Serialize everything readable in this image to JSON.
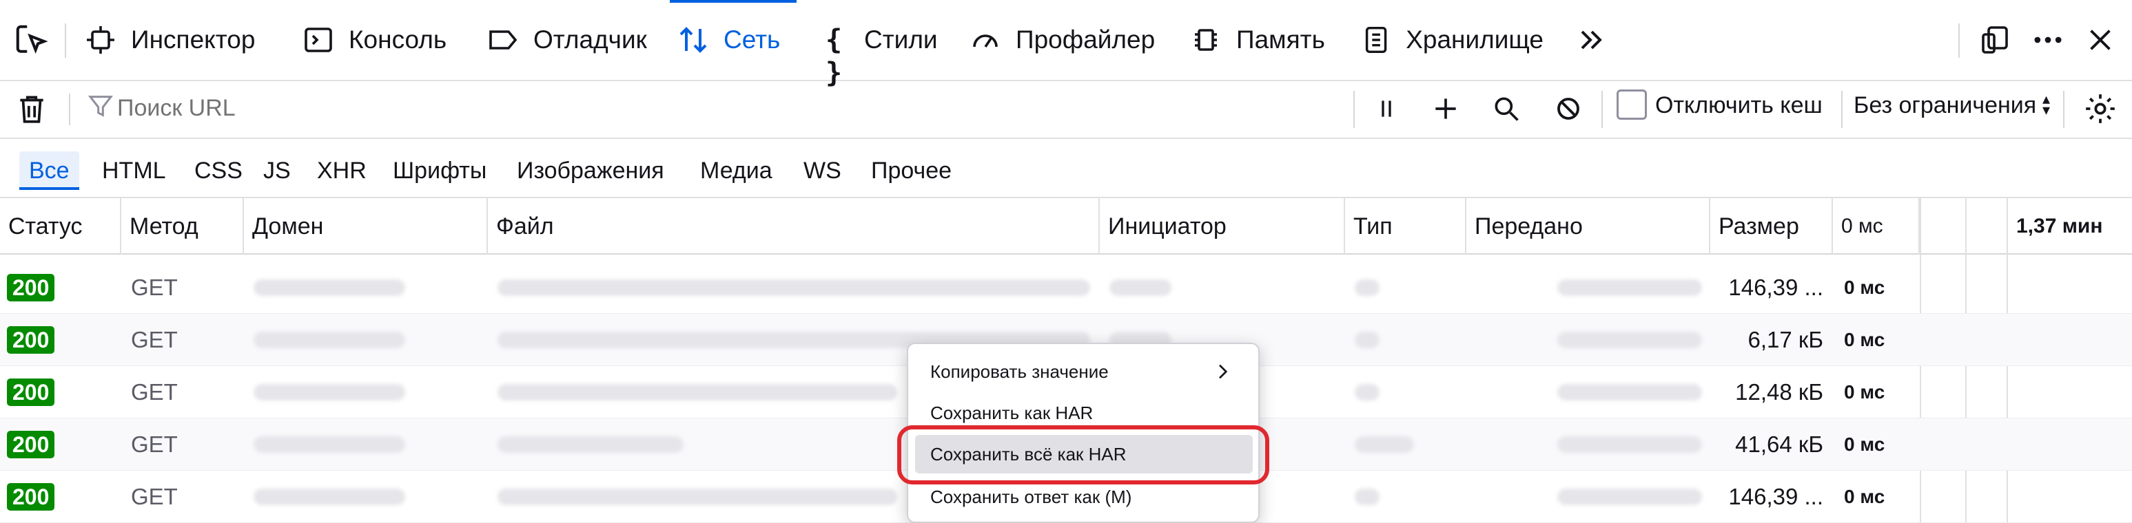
{
  "toolbox": {
    "tabs": [
      {
        "label": "Инспектор",
        "icon": "inspector-icon"
      },
      {
        "label": "Консоль",
        "icon": "console-icon"
      },
      {
        "label": "Отладчик",
        "icon": "debugger-icon"
      },
      {
        "label": "Сеть",
        "icon": "network-icon"
      },
      {
        "label": "Стили",
        "icon": "style-editor-icon"
      },
      {
        "label": "Профайлер",
        "icon": "profiler-icon"
      },
      {
        "label": "Память",
        "icon": "memory-icon"
      },
      {
        "label": "Хранилище",
        "icon": "storage-icon"
      }
    ],
    "active_tab": "Сеть"
  },
  "filter": {
    "search_placeholder": "Поиск URL",
    "disable_cache_label": "Отключить кеш",
    "throttle_value": "Без ограничения"
  },
  "type_filters": [
    "Все",
    "HTML",
    "CSS",
    "JS",
    "XHR",
    "Шрифты",
    "Изображения",
    "Медиа",
    "WS",
    "Прочее"
  ],
  "columns": {
    "status": "Статус",
    "method": "Метод",
    "domain": "Домен",
    "file": "Файл",
    "initiator": "Инициатор",
    "type": "Тип",
    "transferred": "Передано",
    "size": "Размер",
    "waterfall_start": "0 мс",
    "waterfall_end": "1,37 мин"
  },
  "rows": [
    {
      "status": "200",
      "method": "GET",
      "size": "146,39 ...",
      "time": "0 мс"
    },
    {
      "status": "200",
      "method": "GET",
      "size": "6,17 кБ",
      "time": "0 мс"
    },
    {
      "status": "200",
      "method": "GET",
      "size": "12,48 кБ",
      "time": "0 мс"
    },
    {
      "status": "200",
      "method": "GET",
      "size": "41,64 кБ",
      "time": "0 мс"
    },
    {
      "status": "200",
      "method": "GET",
      "size": "146,39 ...",
      "time": "0 мс"
    }
  ],
  "context_menu": {
    "items": [
      "Копировать значение",
      "Сохранить как HAR",
      "Сохранить всё как HAR",
      "Сохранить ответ как (M)"
    ],
    "hovered_item": "Сохранить всё как HAR"
  },
  "colors": {
    "accent": "#0060df",
    "status_ok": "#058b00",
    "highlight": "#e0282e"
  }
}
